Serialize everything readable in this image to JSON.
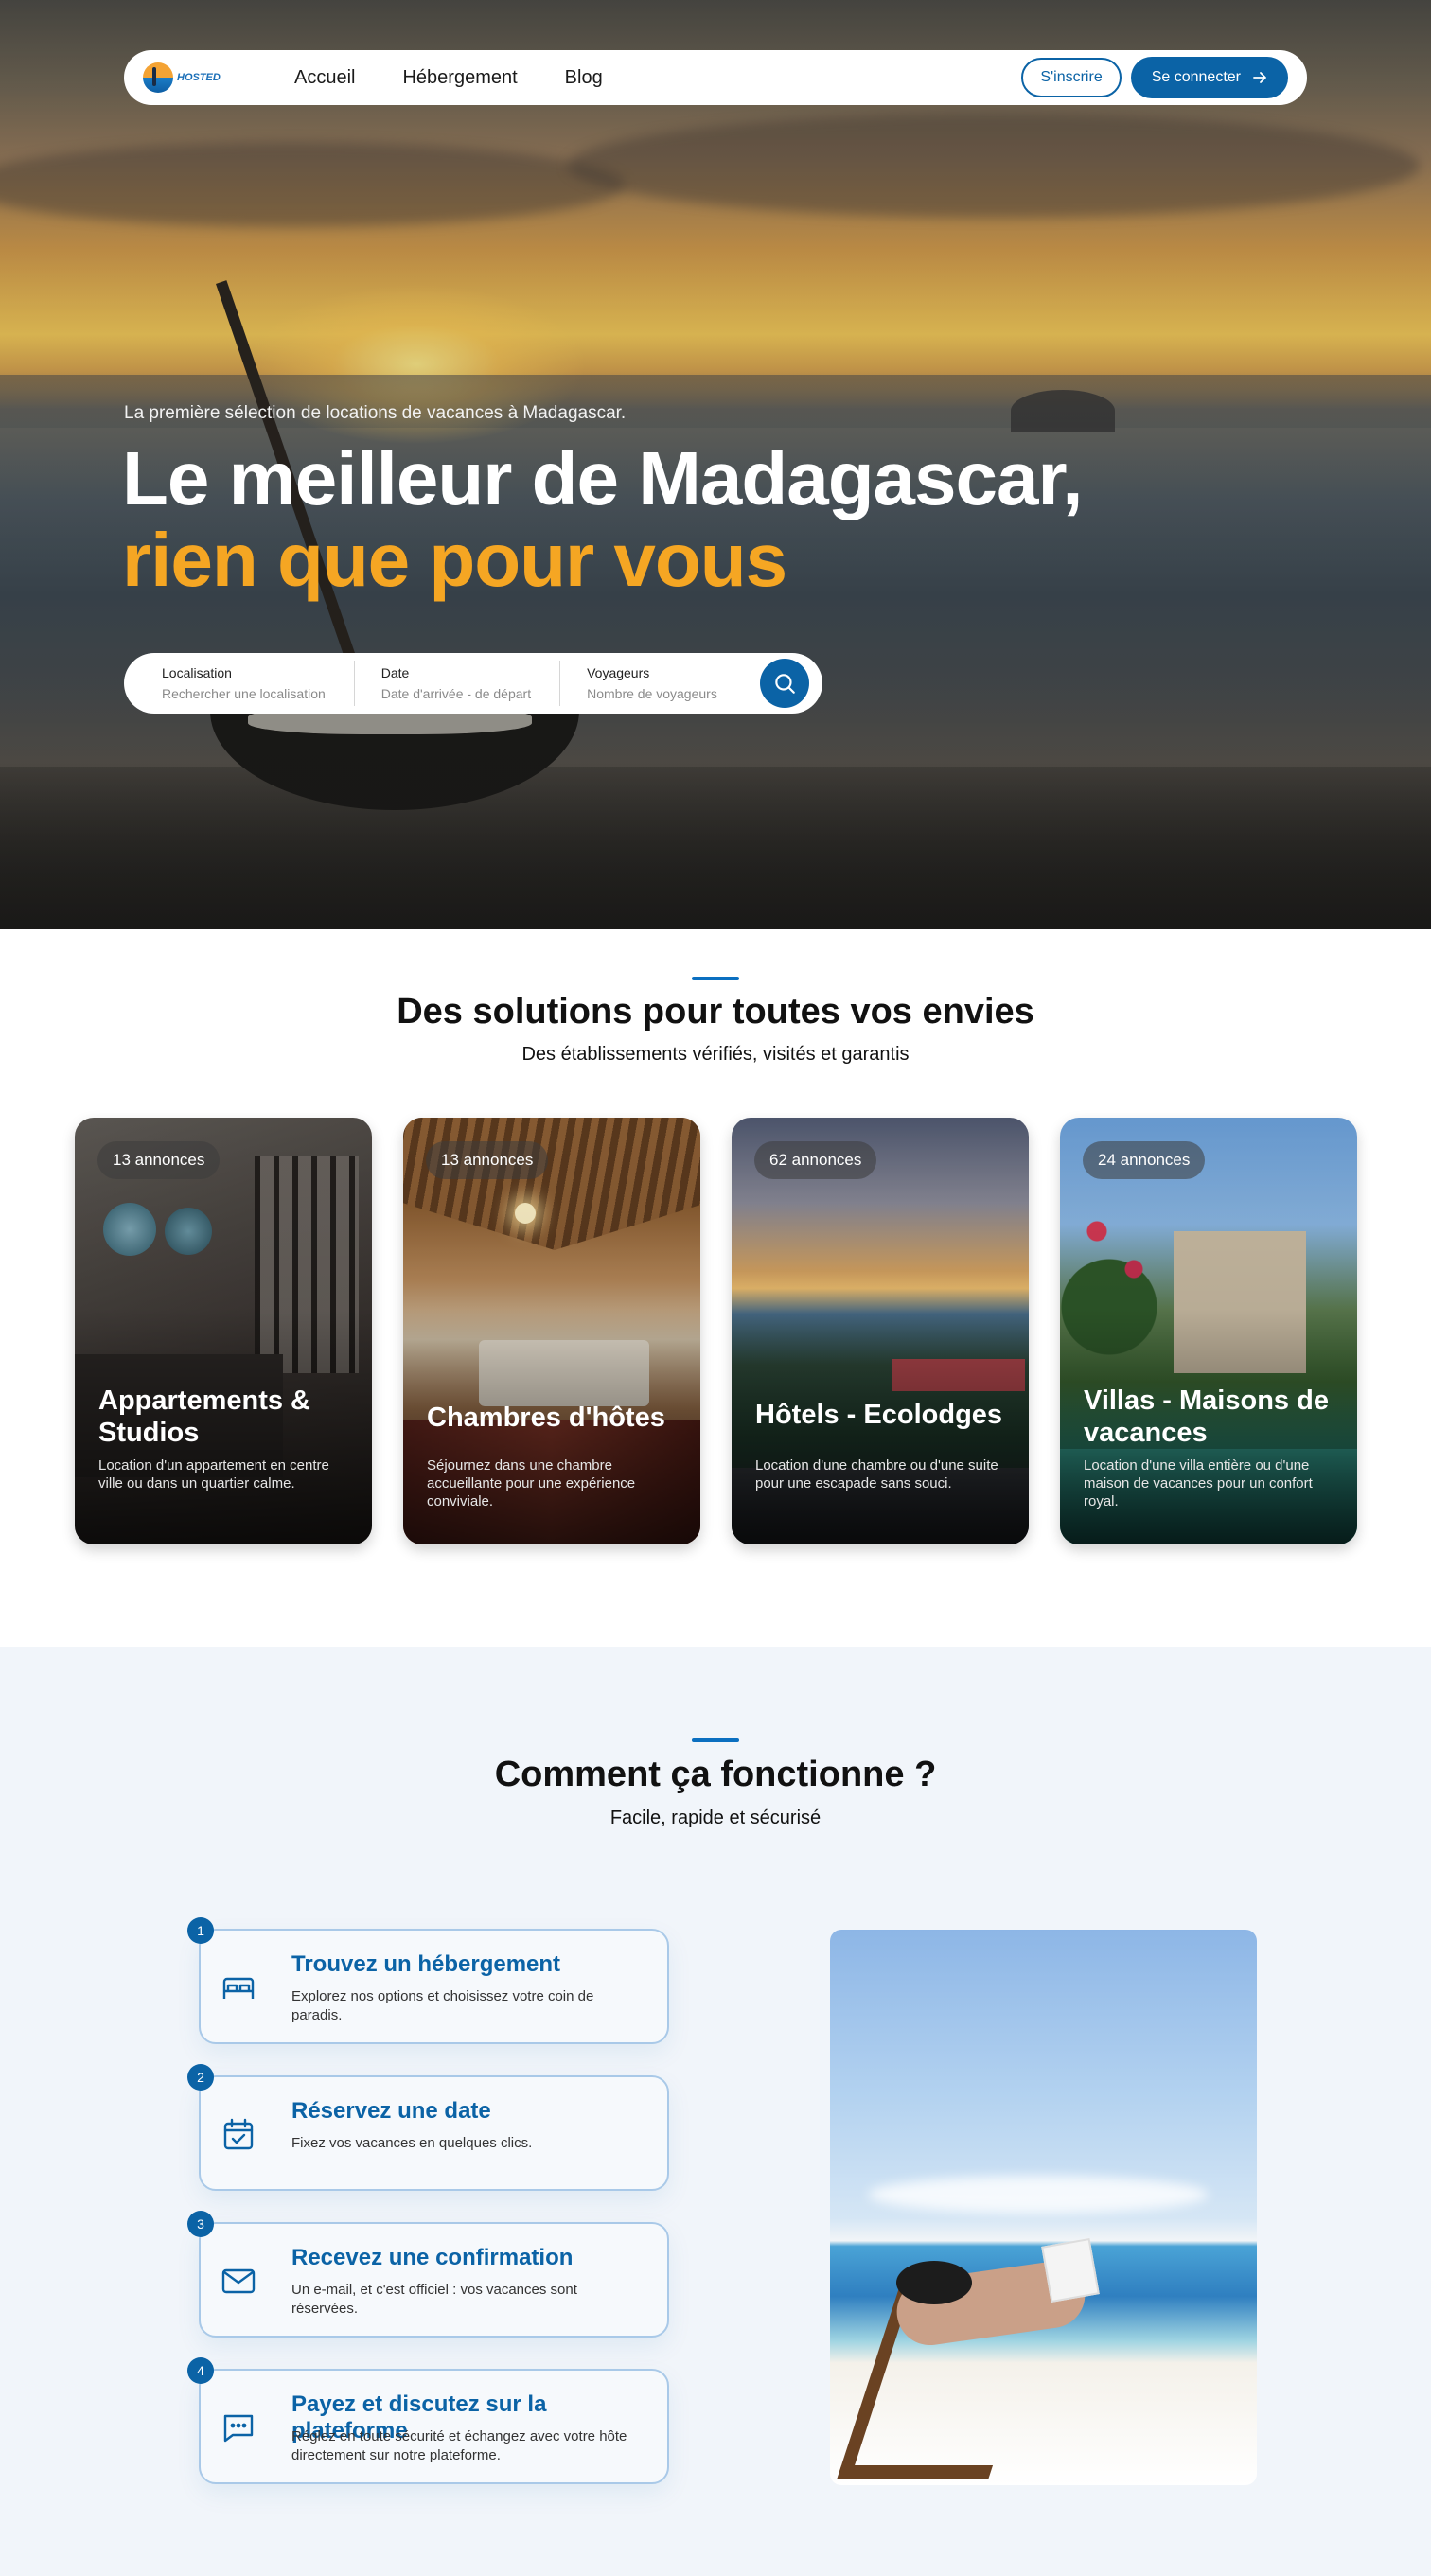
{
  "nav": {
    "logo_text": "HOSTED",
    "links": [
      "Accueil",
      "Hébergement",
      "Blog"
    ],
    "signup": "S'inscrire",
    "login": "Se connecter"
  },
  "hero": {
    "eyebrow": "La première sélection de locations de vacances à Madagascar.",
    "title_line1": "Le meilleur de Madagascar,",
    "title_line2": "rien que pour vous",
    "search": {
      "location_label": "Localisation",
      "location_placeholder": "Rechercher une localisation",
      "date_label": "Date",
      "date_placeholder": "Date d'arrivée - de départ",
      "guests_label": "Voyageurs",
      "guests_placeholder": "Nombre de voyageurs"
    }
  },
  "solutions": {
    "title": "Des solutions pour toutes vos envies",
    "subtitle": "Des établissements vérifiés, visités et garantis",
    "cards": [
      {
        "badge": "13 annonces",
        "title": "Appartements & Studios",
        "desc": "Location d'un appartement en centre ville ou dans un quartier calme."
      },
      {
        "badge": "13 annonces",
        "title": "Chambres d'hôtes",
        "desc": "Séjournez dans une chambre accueillante pour une expérience conviviale."
      },
      {
        "badge": "62 annonces",
        "title": "Hôtels - Ecolodges",
        "desc": "Location d'une chambre ou d'une suite pour une escapade sans souci."
      },
      {
        "badge": "24 annonces",
        "title": "Villas - Maisons de vacances",
        "desc": "Location d'une villa entière ou d'une maison de vacances pour un confort royal."
      }
    ]
  },
  "how": {
    "title": "Comment ça fonctionne ?",
    "subtitle": "Facile, rapide et sécurisé",
    "steps": [
      {
        "num": "1",
        "icon": "bed-icon",
        "title": "Trouvez un hébergement",
        "desc": "Explorez nos options et choisissez votre coin de paradis."
      },
      {
        "num": "2",
        "icon": "calendar-check-icon",
        "title": "Réservez une date",
        "desc": "Fixez vos vacances en quelques clics."
      },
      {
        "num": "3",
        "icon": "mail-icon",
        "title": "Recevez une confirmation",
        "desc": "Un e-mail, et c'est officiel : vos vacances sont réservées."
      },
      {
        "num": "4",
        "icon": "chat-icon",
        "title": "Payez et discutez sur la plateforme",
        "desc": "Réglez en toute sécurité et échangez avec votre hôte directement sur notre plateforme."
      }
    ]
  },
  "colors": {
    "primary": "#0b63a6",
    "accent": "#f5a623",
    "section_bg": "#f1f5fa"
  }
}
